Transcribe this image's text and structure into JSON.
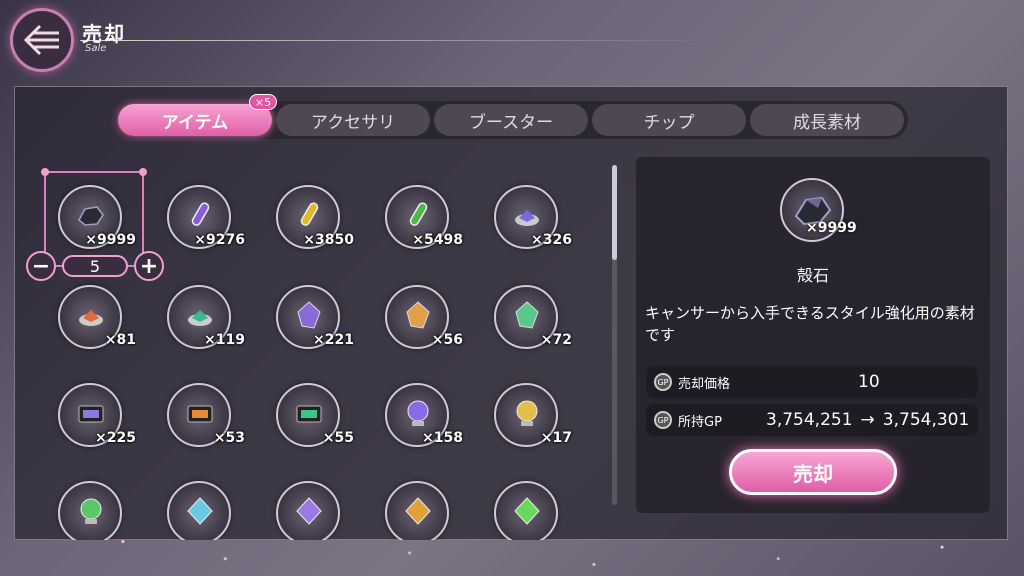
{
  "header": {
    "title": "売却",
    "subtitle": "Sale"
  },
  "tabs": [
    {
      "label": "アイテム",
      "active": true
    },
    {
      "label": "アクセサリ",
      "active": false
    },
    {
      "label": "ブースター",
      "active": false
    },
    {
      "label": "チップ",
      "active": false
    },
    {
      "label": "成長素材",
      "active": false
    }
  ],
  "tab_badge": "×5",
  "stepper": {
    "value": "5",
    "minus": "−",
    "plus": "+"
  },
  "items": [
    {
      "qty": "×9999",
      "icon": "ore-icon",
      "color": "#2a2a35"
    },
    {
      "qty": "×9276",
      "icon": "potion-icon",
      "color": "#8a5ad8"
    },
    {
      "qty": "×3850",
      "icon": "potion-icon",
      "color": "#e0b82a"
    },
    {
      "qty": "×5498",
      "icon": "potion-icon",
      "color": "#4cb84a"
    },
    {
      "qty": "×326",
      "icon": "crystal-stand-icon",
      "color": "#7a6ae0"
    },
    {
      "qty": "×81",
      "icon": "crystal-stand-icon",
      "color": "#e06a3a"
    },
    {
      "qty": "×119",
      "icon": "crystal-stand-icon",
      "color": "#3ab88a"
    },
    {
      "qty": "×221",
      "icon": "gem-shard-icon",
      "color": "#8a6ad8"
    },
    {
      "qty": "×56",
      "icon": "gem-shard-icon",
      "color": "#e0a04a"
    },
    {
      "qty": "×72",
      "icon": "gem-shard-icon",
      "color": "#5ac88a"
    },
    {
      "qty": "×225",
      "icon": "case-icon",
      "color": "#8a7ae0"
    },
    {
      "qty": "×53",
      "icon": "case-icon",
      "color": "#e08a3a"
    },
    {
      "qty": "×55",
      "icon": "case-icon",
      "color": "#3ac88a"
    },
    {
      "qty": "×158",
      "icon": "orb-icon",
      "color": "#8a6ae8"
    },
    {
      "qty": "×17",
      "icon": "orb-icon",
      "color": "#e0c04a"
    },
    {
      "qty": "",
      "icon": "orb-icon",
      "color": "#5ac86a"
    },
    {
      "qty": "",
      "icon": "gem-icon",
      "color": "#6ac8e0"
    },
    {
      "qty": "",
      "icon": "gem-icon",
      "color": "#9a7ae0"
    },
    {
      "qty": "",
      "icon": "gem-icon",
      "color": "#e0a03a"
    },
    {
      "qty": "",
      "icon": "gem-icon",
      "color": "#6ad85a"
    }
  ],
  "detail": {
    "qty": "×9999",
    "name": "殻石",
    "description": "キャンサーから入手できるスタイル強化用の素材です",
    "sell_price_label": "売却価格",
    "sell_price": "10",
    "gp_label": "所持GP",
    "gp_before": "3,754,251",
    "arrow": "→",
    "gp_after": "3,754,301",
    "gp_icon_text": "GP"
  },
  "sell_button": "売却",
  "colors": {
    "accent": "#e05fa9",
    "accent_light": "#f8a3d2"
  }
}
